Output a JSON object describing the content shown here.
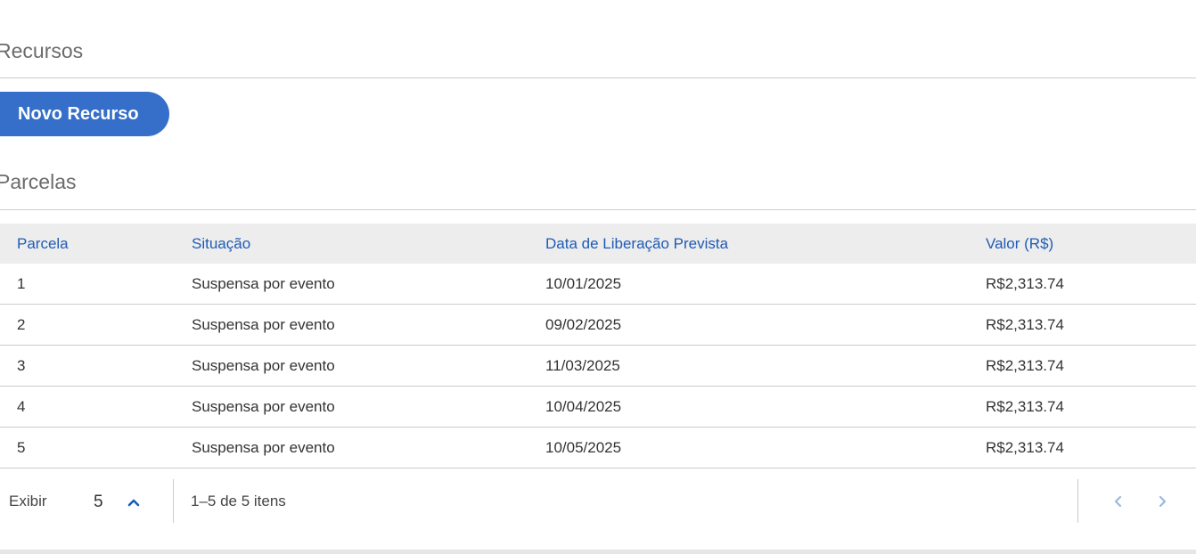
{
  "sections": {
    "recursos_title": "Recursos",
    "novo_recurso_label": "Novo Recurso",
    "parcelas_title": "Parcelas"
  },
  "table": {
    "headers": [
      "Parcela",
      "Situação",
      "Data de Liberação Prevista",
      "Valor (R$)"
    ],
    "rows": [
      [
        "1",
        "Suspensa por evento",
        "10/01/2025",
        "R$2,313.74"
      ],
      [
        "2",
        "Suspensa por evento",
        "09/02/2025",
        "R$2,313.74"
      ],
      [
        "3",
        "Suspensa por evento",
        "11/03/2025",
        "R$2,313.74"
      ],
      [
        "4",
        "Suspensa por evento",
        "10/04/2025",
        "R$2,313.74"
      ],
      [
        "5",
        "Suspensa por evento",
        "10/05/2025",
        "R$2,313.74"
      ]
    ]
  },
  "pagination": {
    "show_label": "Exibir",
    "page_size": "5",
    "items_text": "1–5 de 5 itens"
  },
  "icons": {
    "page_size_toggle": "chevron-up-icon",
    "prev": "chevron-left-icon",
    "next": "chevron-right-icon"
  },
  "colors": {
    "primary": "#356fc9",
    "header_text": "#1f5bb5",
    "header_bg": "#ededed",
    "nav_disabled": "#9db8df"
  }
}
